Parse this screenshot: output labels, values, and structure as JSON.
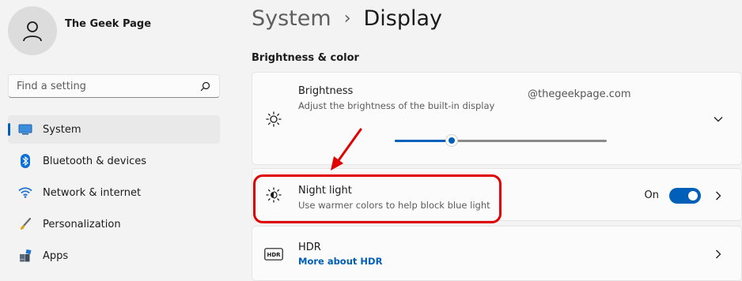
{
  "sidebar": {
    "user_name": "The Geek Page",
    "search": {
      "placeholder": "Find a setting"
    },
    "items": [
      {
        "label": "System",
        "icon": "monitor-icon",
        "active": true
      },
      {
        "label": "Bluetooth & devices",
        "icon": "bluetooth-icon",
        "active": false
      },
      {
        "label": "Network & internet",
        "icon": "wifi-icon",
        "active": false
      },
      {
        "label": "Personalization",
        "icon": "brush-icon",
        "active": false
      },
      {
        "label": "Apps",
        "icon": "apps-icon",
        "active": false
      }
    ]
  },
  "main": {
    "breadcrumb": {
      "parent": "System",
      "separator": "›",
      "current": "Display"
    },
    "section_title": "Brightness & color",
    "watermark": "@thegeekpage.com",
    "brightness": {
      "title": "Brightness",
      "subtitle": "Adjust the brightness of the built-in display",
      "level": 0.27
    },
    "night_light": {
      "title": "Night light",
      "subtitle": "Use warmer colors to help block blue light",
      "toggle_label": "On",
      "enabled": true
    },
    "hdr": {
      "title": "HDR",
      "link": "More about HDR",
      "icon_text": "HDR"
    }
  },
  "colors": {
    "accent": "#005fb8",
    "annotation": "#e00000",
    "background": "#f3f3f3",
    "card": "#fbfbfb"
  }
}
